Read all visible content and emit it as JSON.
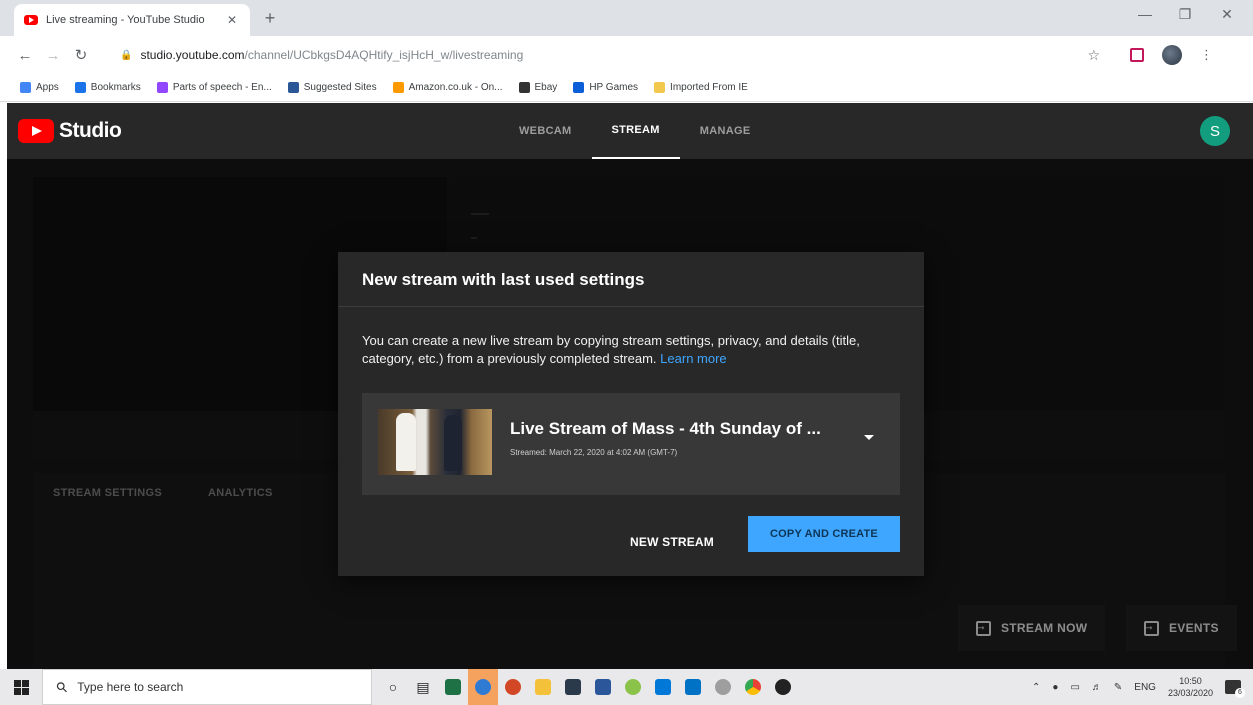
{
  "browser": {
    "tab_title": "Live streaming - YouTube Studio",
    "tab_close": "✕",
    "new_tab": "+",
    "url_host": "studio.youtube.com",
    "url_path": "/channel/UCbkgsD4AQHtify_isjHcH_w/livestreaming",
    "bookmarks": [
      {
        "label": "Apps",
        "color": "#4285f4"
      },
      {
        "label": "Bookmarks",
        "color": "#1a73e8"
      },
      {
        "label": "Parts of speech - En...",
        "color": "#9146ff"
      },
      {
        "label": "Suggested Sites",
        "color": "#2b5797"
      },
      {
        "label": "Amazon.co.uk - On...",
        "color": "#ff9900"
      },
      {
        "label": "Ebay",
        "color": "#333333"
      },
      {
        "label": "HP Games",
        "color": "#0b5ed7"
      },
      {
        "label": "Imported From IE",
        "color": "#f2c94c"
      }
    ]
  },
  "studio": {
    "logo_text": "Studio",
    "nav": [
      {
        "label": "WEBCAM",
        "active": false
      },
      {
        "label": "STREAM",
        "active": true
      },
      {
        "label": "MANAGE",
        "active": false
      }
    ],
    "avatar_letter": "S",
    "sub_tabs": [
      "STREAM SETTINGS",
      "ANALYTICS"
    ],
    "stream_now_label": "STREAM NOW",
    "events_label": "EVENTS"
  },
  "dialog": {
    "title": "New stream with last used settings",
    "body": "You can create a new live stream by copying stream settings, privacy, and details (title, category, etc.) from a previously completed stream.",
    "learn_more": "Learn more",
    "stream_title": "Live Stream of Mass - 4th Sunday of ...",
    "stream_meta": "Streamed: March 22, 2020 at 4:02 AM (GMT-7)",
    "new_stream_label": "NEW STREAM",
    "copy_create_label": "COPY AND CREATE"
  },
  "taskbar": {
    "search_placeholder": "Type here to search",
    "language": "ENG",
    "time": "10:50",
    "date": "23/03/2020",
    "notification_count": "6"
  },
  "colors": {
    "accent": "#3ea6ff",
    "youtube_red": "#ff0000",
    "avatar": "#129e7e"
  }
}
